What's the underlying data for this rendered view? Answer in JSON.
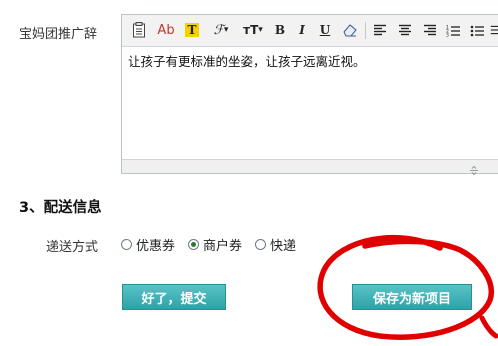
{
  "promo": {
    "label": "宝妈团推广辞",
    "text": "让孩子有更标准的坐姿，让孩子远离近视。"
  },
  "toolbar": {
    "font_color_label": "Ab",
    "font_size_label": "тТ",
    "bold_label": "B",
    "italic_label": "I",
    "underline_label": "U",
    "dropdown_glyph": "▾",
    "highlight_color": "#f5d100",
    "font_color": "#c0392b"
  },
  "delivery_section": {
    "title": "3、配送信息",
    "method_label": "递送方式",
    "options": [
      {
        "label": "优惠券",
        "checked": false
      },
      {
        "label": "商户券",
        "checked": true
      },
      {
        "label": "快递",
        "checked": false
      }
    ]
  },
  "actions": {
    "submit_label": "好了，提交",
    "save_label": "保存为新项目",
    "button_color": "#3aacb0"
  },
  "annotation": {
    "marker_color": "#e00000"
  }
}
